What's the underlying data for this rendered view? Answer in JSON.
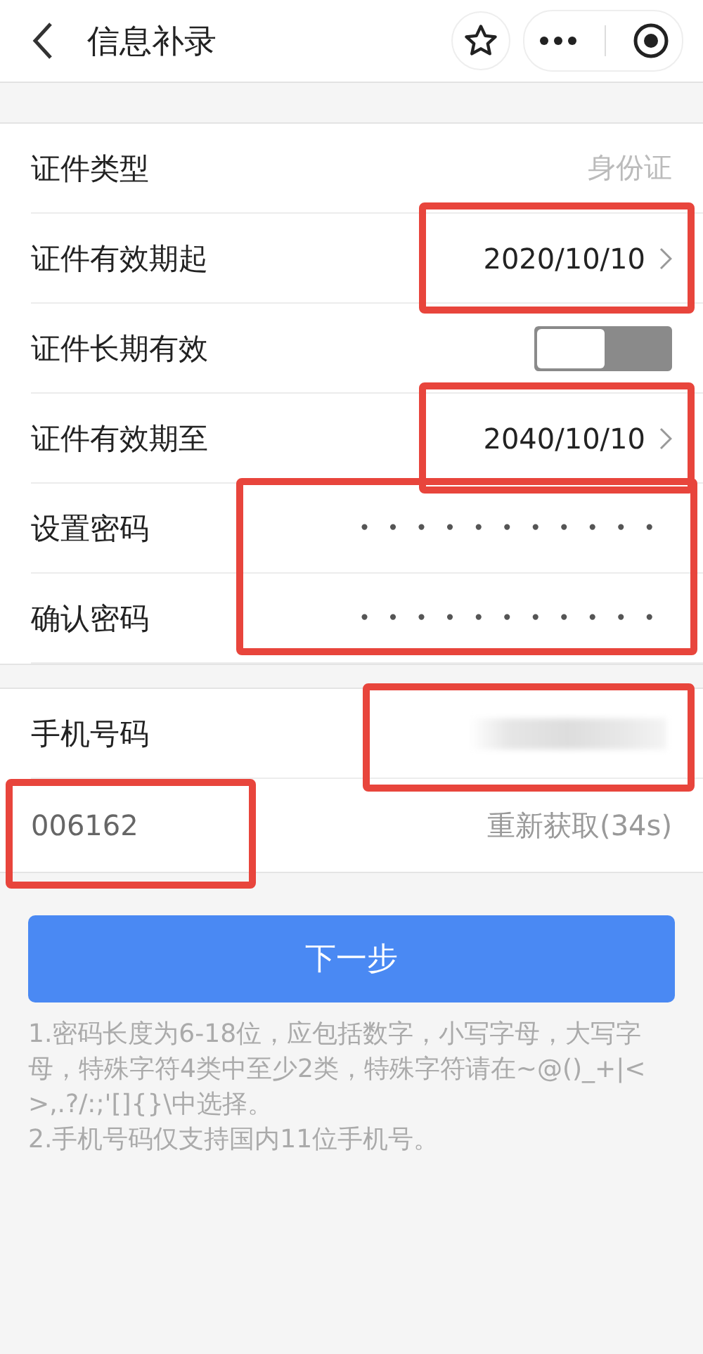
{
  "header": {
    "title": "信息补录"
  },
  "card_1": [
    {
      "kind": "static",
      "label": "证件类型",
      "value": "身份证",
      "highlighted": false
    },
    {
      "kind": "date",
      "label": "证件有效期起",
      "value": "2020/10/10",
      "highlighted": true
    },
    {
      "kind": "switch",
      "label": "证件长期有效",
      "on": false,
      "highlighted": false
    },
    {
      "kind": "date",
      "label": "证件有效期至",
      "value": "2040/10/10",
      "highlighted": true
    },
    {
      "kind": "group",
      "highlighted": true,
      "rows": [
        {
          "kind": "password",
          "label": "设置密码",
          "value": "•••••••••••"
        },
        {
          "kind": "password",
          "label": "确认密码",
          "value": "•••••••••••"
        }
      ]
    }
  ],
  "card_2": [
    {
      "kind": "blurred",
      "label": "手机号码",
      "highlighted": true
    },
    {
      "kind": "code",
      "value": "006162",
      "resend": "重新获取(34s)",
      "highlighted": true
    }
  ],
  "next_button": "下一步",
  "notes": [
    "1.密码长度为6-18位，应包括数字，小写字母，大写字母，特殊字符4类中至少2类，特殊字符请在~@()_+|<>,.?/:;'[]{}\\中选择。",
    "2.手机号码仅支持国内11位手机号。"
  ]
}
